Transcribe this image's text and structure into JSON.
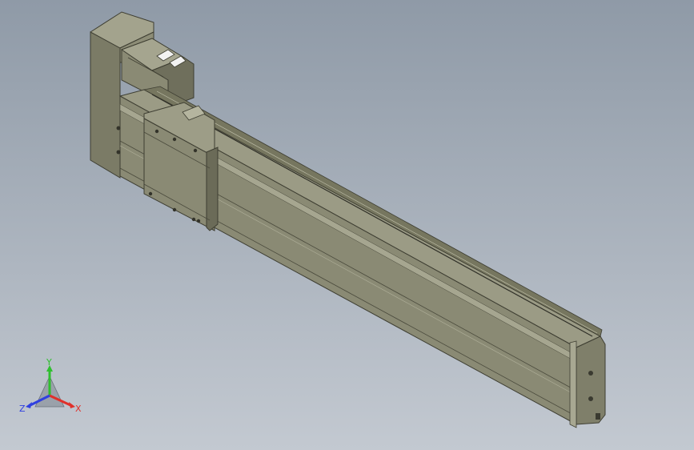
{
  "viewport": {
    "background_top": "#8f9aa7",
    "background_bottom": "#c3c9d1",
    "model_color": "#8a8a74",
    "model_dark": "#5d5d4c",
    "model_light": "#a2a28c"
  },
  "triad": {
    "x_label": "X",
    "y_label": "Y",
    "z_label": "Z",
    "x_color": "#e0302a",
    "y_color": "#2fbf2f",
    "z_color": "#3040e0"
  }
}
